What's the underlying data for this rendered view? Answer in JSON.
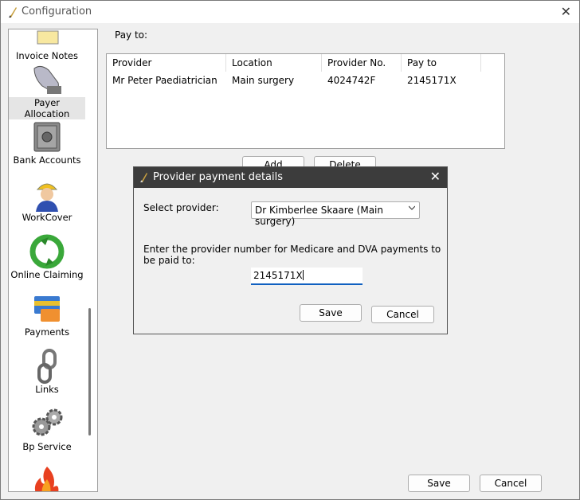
{
  "window": {
    "title": "Configuration"
  },
  "sidebar": {
    "items": [
      {
        "label": "Invoice Notes",
        "icon": "invoice-notes-icon"
      },
      {
        "label": "Payer Allocation",
        "icon": "payer-allocation-icon",
        "selected": true
      },
      {
        "label": "Bank Accounts",
        "icon": "safe-icon"
      },
      {
        "label": "WorkCover",
        "icon": "worker-icon"
      },
      {
        "label": "Online Claiming",
        "icon": "recycle-icon"
      },
      {
        "label": "Payments",
        "icon": "payment-cards-icon"
      },
      {
        "label": "Links",
        "icon": "chain-link-icon"
      },
      {
        "label": "Bp Service",
        "icon": "gears-icon"
      }
    ]
  },
  "main": {
    "pay_to_label": "Pay to:",
    "table": {
      "headers": [
        "Provider",
        "Location",
        "Provider No.",
        "Pay to"
      ],
      "rows": [
        [
          "Mr Peter Paediatrician",
          "Main surgery",
          "4024742F",
          "2145171X"
        ]
      ]
    },
    "add_label": "Add",
    "delete_label": "Delete",
    "save_label": "Save",
    "cancel_label": "Cancel"
  },
  "dialog": {
    "title": "Provider payment details",
    "select_label": "Select provider:",
    "select_value": "Dr Kimberlee Skaare (Main surgery)",
    "instruction": "Enter the provider number for Medicare and DVA payments to be paid to:",
    "input_value": "2145171X",
    "save_label": "Save",
    "cancel_label": "Cancel"
  },
  "colors": {
    "dialog_title_bg": "#3c3c3c",
    "focus_underline": "#1060c0"
  }
}
